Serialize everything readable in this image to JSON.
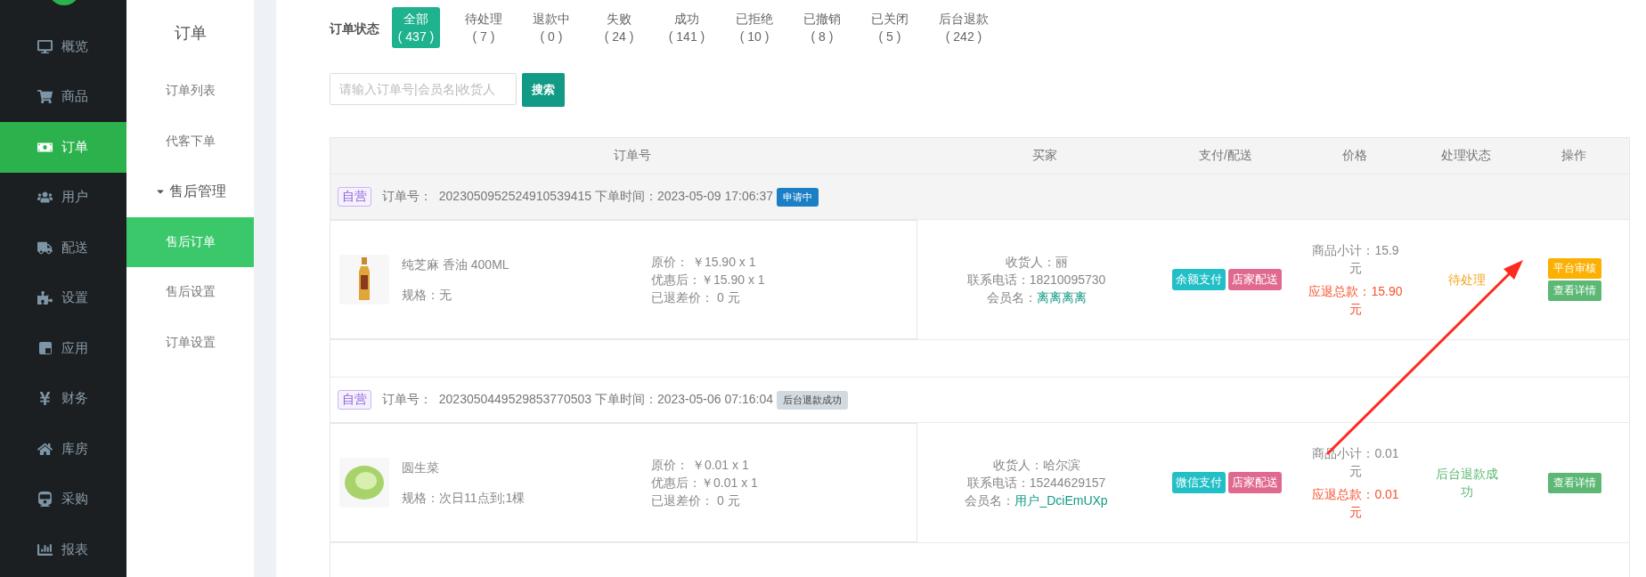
{
  "sidebar": {
    "items": [
      {
        "label": "概览",
        "selected": false
      },
      {
        "label": "商品",
        "selected": false
      },
      {
        "label": "订单",
        "selected": true
      },
      {
        "label": "用户",
        "selected": false
      },
      {
        "label": "配送",
        "selected": false
      },
      {
        "label": "设置",
        "selected": false
      },
      {
        "label": "应用",
        "selected": false
      },
      {
        "label": "财务",
        "selected": false
      },
      {
        "label": "库房",
        "selected": false
      },
      {
        "label": "采购",
        "selected": false
      },
      {
        "label": "报表",
        "selected": false
      }
    ]
  },
  "submenu": {
    "title": "订单",
    "items": [
      {
        "kind": "link",
        "label": "订单列表",
        "selected": false
      },
      {
        "kind": "link",
        "label": "代客下单",
        "selected": false
      },
      {
        "kind": "group",
        "label": "售后管理",
        "expanded": true
      },
      {
        "kind": "link",
        "label": "售后订单",
        "selected": true
      },
      {
        "kind": "link",
        "label": "售后设置",
        "selected": false
      },
      {
        "kind": "link",
        "label": "订单设置",
        "selected": false
      }
    ]
  },
  "status_filter": {
    "label": "订单状态",
    "tabs": [
      {
        "label": "全部",
        "count": "( 437 )",
        "selected": true
      },
      {
        "label": "待处理",
        "count": "( 7 )",
        "selected": false
      },
      {
        "label": "退款中",
        "count": "( 0 )",
        "selected": false
      },
      {
        "label": "失败",
        "count": "( 24 )",
        "selected": false
      },
      {
        "label": "成功",
        "count": "( 141 )",
        "selected": false
      },
      {
        "label": "已拒绝",
        "count": "( 10 )",
        "selected": false
      },
      {
        "label": "已撤销",
        "count": "( 8 )",
        "selected": false
      },
      {
        "label": "已关闭",
        "count": "( 5 )",
        "selected": false
      },
      {
        "label": "后台退款",
        "count": "( 242 )",
        "selected": false
      }
    ]
  },
  "search": {
    "placeholder": "请输入订单号|会员名|收货人",
    "button": "搜索"
  },
  "table": {
    "columns": [
      "订单号",
      "买家",
      "支付/配送",
      "价格",
      "处理状态",
      "操作"
    ],
    "orders": [
      {
        "source": "自营",
        "order_no": "订单号：  2023050952524910539415 下单时间：2023-05-09 17:06:37",
        "badge": {
          "text": "申请中",
          "color": "#1b7fc6"
        },
        "product": {
          "name": "纯芝麻 香油 400ML",
          "spec": "规格：无"
        },
        "prices": [
          "原价： ￥15.90 x 1",
          "优惠后：￥15.90 x 1",
          "已退差价：  0 元"
        ],
        "buyer": {
          "receiver": "收货人：丽",
          "phone": "联系电话：18210095730",
          "member_label": "会员名：",
          "member": "离离离离"
        },
        "tags": [
          {
            "text": "余额支付",
            "color": "#22c0c6"
          },
          {
            "text": "店家配送",
            "color": "#e06a8f"
          }
        ],
        "subtotal": "商品小计：15.9元",
        "refund": "应退总款：15.90 元",
        "status": {
          "text": "待处理",
          "kind": "pending"
        },
        "actions": [
          {
            "label": "平台审核",
            "color": "#fbb003"
          },
          {
            "label": "查看详情",
            "color": "#5cb874"
          }
        ]
      },
      {
        "source": "自营",
        "order_no": "订单号：  2023050449529853770503 下单时间：2023-05-06 07:16:04",
        "badge": {
          "text": "后台退款成功",
          "color": "#d3dadf"
        },
        "product": {
          "name": "圆生菜",
          "spec": "规格：次日11点到;1棵"
        },
        "prices": [
          "原价： ￥0.01 x 1",
          "优惠后：￥0.01 x 1",
          "已退差价：  0 元"
        ],
        "buyer": {
          "receiver": "收货人：哈尔滨",
          "phone": "联系电话：15244629157",
          "member_label": "会员名：",
          "member": "用户_DciEmUXp"
        },
        "tags": [
          {
            "text": "微信支付",
            "color": "#22c0c6"
          },
          {
            "text": "店家配送",
            "color": "#e06a8f"
          }
        ],
        "subtotal": "商品小计：0.01元",
        "refund": "应退总款：0.01元",
        "status": {
          "text": "后台退款成功",
          "kind": "done"
        },
        "actions": [
          {
            "label": "查看详情",
            "color": "#5cb874"
          }
        ]
      }
    ]
  }
}
